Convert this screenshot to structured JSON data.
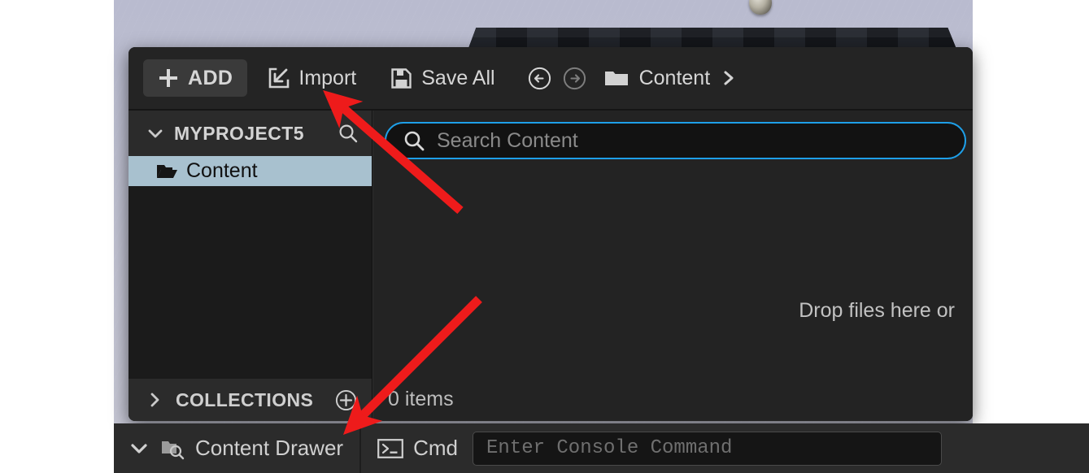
{
  "viewport": {
    "name": "level-viewport-background"
  },
  "toolbar": {
    "add_label": "ADD",
    "add_icon": "plus-icon",
    "import_label": "Import",
    "import_icon": "import-icon",
    "save_all_label": "Save All",
    "save_all_icon": "floppy-disk-icon",
    "back_icon": "arrow-left-circle-icon",
    "forward_icon": "arrow-right-circle-icon",
    "folder_icon": "folder-icon",
    "breadcrumb_label": "Content",
    "breadcrumb_chevron_icon": "chevron-right-icon"
  },
  "sources": {
    "project_title": "MYPROJECT5",
    "project_chevron_icon": "chevron-down-icon",
    "project_search_icon": "search-icon",
    "tree": [
      {
        "label": "Content",
        "icon": "folder-open-icon",
        "selected": true
      }
    ],
    "collections_title": "COLLECTIONS",
    "collections_chevron_icon": "chevron-right-icon",
    "collections_add_icon": "plus-circle-icon"
  },
  "assets": {
    "search_icon": "search-icon",
    "search_placeholder": "Search Content",
    "search_value": "",
    "drop_hint": "Drop files here or",
    "item_count": "0 items"
  },
  "statusbar": {
    "content_drawer_label": "Content Drawer",
    "content_drawer_chevron_icon": "chevron-down-icon",
    "content_drawer_icon": "folder-search-icon",
    "cmd_label": "Cmd",
    "cmd_icon": "terminal-icon",
    "console_placeholder": "Enter Console Command",
    "console_value": ""
  },
  "annotations": {
    "arrow_color": "#ee1b1b",
    "arrow_1_target": "import-button",
    "arrow_2_target": "content-drawer-button"
  },
  "colors": {
    "accent_focus": "#1e9fe8",
    "selection": "#a8c1cf",
    "panel_bg": "#242424",
    "toolbar_header_bg": "#2b2b2b"
  }
}
